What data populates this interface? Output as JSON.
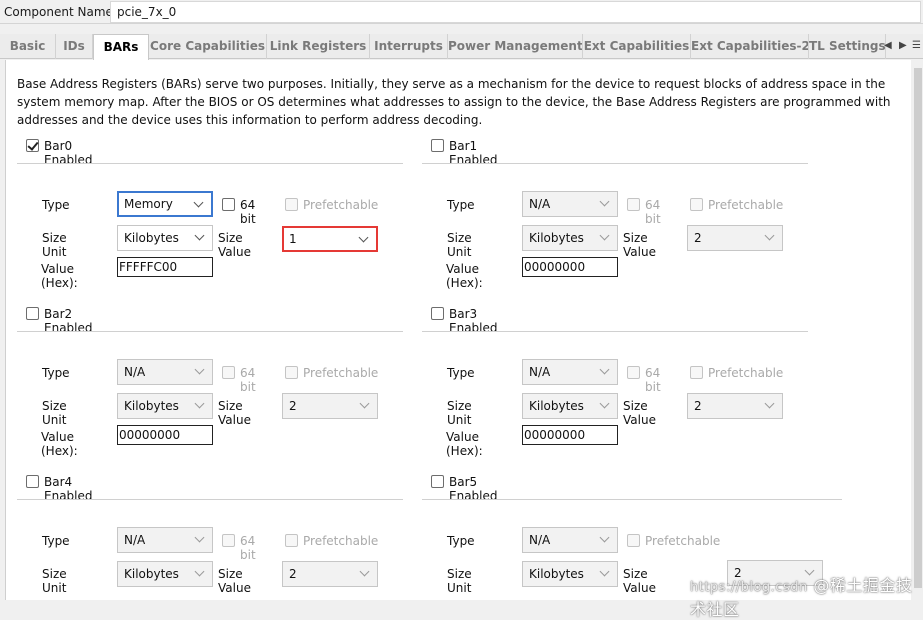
{
  "component": {
    "label": "Component Name",
    "value": "pcie_7x_0"
  },
  "tabs": [
    {
      "label": "Basic"
    },
    {
      "label": "IDs"
    },
    {
      "label": "BARs",
      "active": true
    },
    {
      "label": "Core Capabilities"
    },
    {
      "label": "Link Registers"
    },
    {
      "label": "Interrupts"
    },
    {
      "label": "Power Management"
    },
    {
      "label": "Ext Capabilities"
    },
    {
      "label": "Ext Capabilities-2"
    },
    {
      "label": "TL Settings"
    }
  ],
  "tab_nav": {
    "left": "◀",
    "right": "▶",
    "menu": "☰"
  },
  "description": "Base Address Registers (BARs) serve two purposes. Initially, they serve as a mechanism for the device to request blocks of address space in the system memory map. After the BIOS or OS determines what addresses to assign to the device, the Base Address Registers are programmed with addresses and the device uses this information to perform address decoding.",
  "labels": {
    "type": "Type",
    "size_unit": "Size Unit",
    "size_value": "Size Value",
    "value_hex": "Value (Hex):",
    "bit64": "64 bit",
    "prefetchable": "Prefetchable"
  },
  "bars": [
    {
      "title": "Bar0 Enabled",
      "enabled": true,
      "type": "Memory",
      "size_unit": "Kilobytes",
      "size_value": "1",
      "hex": "FFFFFC00"
    },
    {
      "title": "Bar1 Enabled",
      "enabled": false,
      "type": "N/A",
      "size_unit": "Kilobytes",
      "size_value": "2",
      "hex": "00000000"
    },
    {
      "title": "Bar2 Enabled",
      "enabled": false,
      "type": "N/A",
      "size_unit": "Kilobytes",
      "size_value": "2",
      "hex": "00000000"
    },
    {
      "title": "Bar3 Enabled",
      "enabled": false,
      "type": "N/A",
      "size_unit": "Kilobytes",
      "size_value": "2",
      "hex": "00000000"
    },
    {
      "title": "Bar4 Enabled",
      "enabled": false,
      "type": "N/A",
      "size_unit": "Kilobytes",
      "size_value": "2"
    },
    {
      "title": "Bar5 Enabled",
      "enabled": false,
      "type": "N/A",
      "size_unit": "Kilobytes",
      "size_value": "2"
    }
  ],
  "watermark": {
    "main": "@稀土掘金技术社区",
    "faint": "https://blog.csdn"
  }
}
